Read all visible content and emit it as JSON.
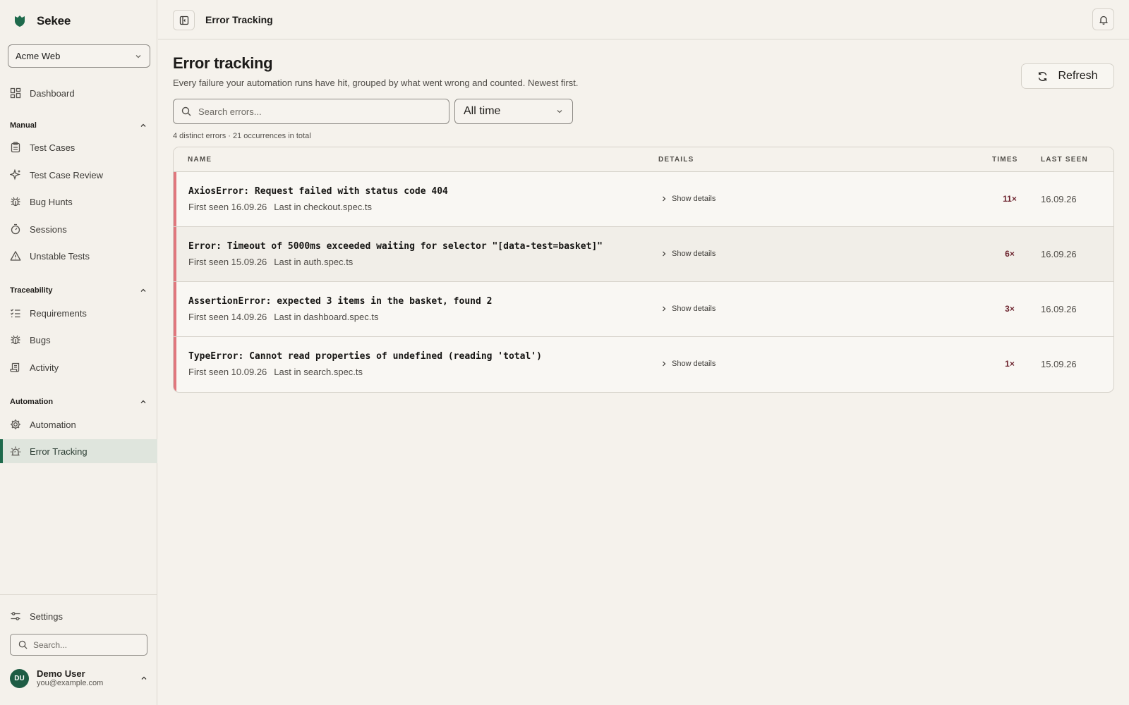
{
  "brand": {
    "name": "Sekee",
    "color": "#1e6a4c"
  },
  "project_selector": {
    "value": "Acme Web"
  },
  "sidebar": {
    "dashboard": "Dashboard",
    "sections": [
      {
        "title": "Manual",
        "items": [
          {
            "label": "Test Cases",
            "icon": "clipboard-icon"
          },
          {
            "label": "Test Case Review",
            "icon": "sparkle-icon"
          },
          {
            "label": "Bug Hunts",
            "icon": "bug-icon"
          },
          {
            "label": "Sessions",
            "icon": "timer-icon"
          },
          {
            "label": "Unstable Tests",
            "icon": "warning-icon"
          }
        ]
      },
      {
        "title": "Traceability",
        "items": [
          {
            "label": "Requirements",
            "icon": "checklist-icon"
          },
          {
            "label": "Bugs",
            "icon": "bug-icon"
          },
          {
            "label": "Activity",
            "icon": "scroll-icon"
          }
        ]
      },
      {
        "title": "Automation",
        "items": [
          {
            "label": "Automation",
            "icon": "gear-icon"
          },
          {
            "label": "Error Tracking",
            "icon": "siren-icon",
            "active": true
          }
        ]
      }
    ],
    "settings": "Settings",
    "search_placeholder": "Search...",
    "user": {
      "initials": "DU",
      "name": "Demo User",
      "email": "you@example.com"
    }
  },
  "topbar": {
    "title": "Error Tracking"
  },
  "main": {
    "title": "Error tracking",
    "description": "Every failure your automation runs have hit, grouped by what went wrong and counted. Newest first.",
    "refresh_label": "Refresh",
    "search_placeholder": "Search errors...",
    "time_range": "All time",
    "summary": "4 distinct errors · 21 occurrences in total",
    "columns": {
      "name": "NAME",
      "details": "DETAILS",
      "times": "TIMES",
      "last_seen": "LAST SEEN"
    },
    "show_details_label": "Show details",
    "errors": [
      {
        "name": "AxiosError: Request failed with status code 404",
        "first_seen": "First seen 16.09.26",
        "last_in": "Last in checkout.spec.ts",
        "times": "11×",
        "last_seen": "16.09.26"
      },
      {
        "name": "Error: Timeout of 5000ms exceeded waiting for selector \"[data-test=basket]\"",
        "first_seen": "First seen 15.09.26",
        "last_in": "Last in auth.spec.ts",
        "times": "6×",
        "last_seen": "16.09.26"
      },
      {
        "name": "AssertionError: expected 3 items in the basket, found 2",
        "first_seen": "First seen 14.09.26",
        "last_in": "Last in dashboard.spec.ts",
        "times": "3×",
        "last_seen": "16.09.26"
      },
      {
        "name": "TypeError: Cannot read properties of undefined (reading 'total')",
        "first_seen": "First seen 10.09.26",
        "last_in": "Last in search.spec.ts",
        "times": "1×",
        "last_seen": "15.09.26"
      }
    ]
  },
  "colors": {
    "accent": "#1e6a4c",
    "error_bar": "#e0777d",
    "count": "#6e2630",
    "background": "#f5f2ec"
  }
}
